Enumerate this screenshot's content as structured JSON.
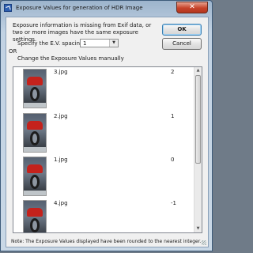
{
  "window": {
    "title": "Exposure Values for generation of HDR Image",
    "close_glyph": "✕"
  },
  "dialog": {
    "message": "Exposure information is missing from Exif data, or two or more images have the same exposure settings.",
    "spacing_label": "Specify the E.V. spacing:",
    "spacing_value": "1",
    "or_label": "OR",
    "manual_label": "Change the Exposure Values manually",
    "ok_label": "OK",
    "cancel_label": "Cancel"
  },
  "images": [
    {
      "filename": "3.jpg",
      "ev": "2"
    },
    {
      "filename": "2.jpg",
      "ev": "1"
    },
    {
      "filename": "1.jpg",
      "ev": "0"
    },
    {
      "filename": "4.jpg",
      "ev": "-1"
    }
  ],
  "note": "Note: The Exposure Values displayed have been rounded to the nearest integer."
}
